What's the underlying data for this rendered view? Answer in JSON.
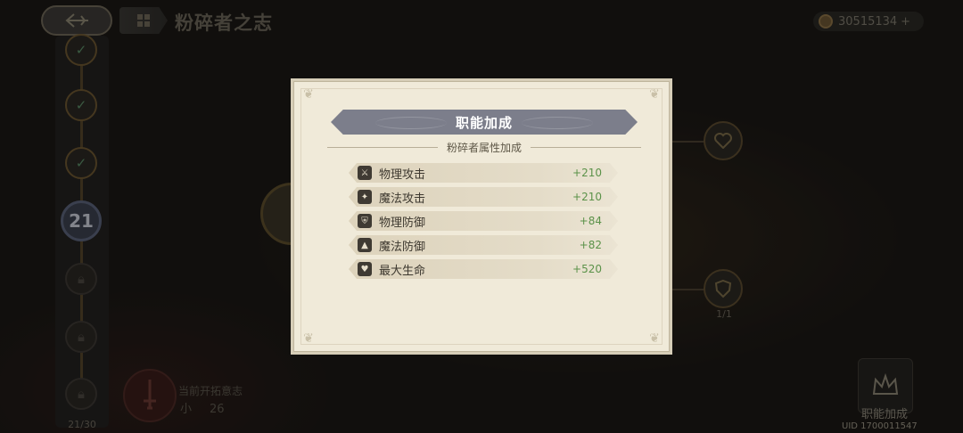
{
  "header": {
    "title": "粉碎者之志",
    "currency_value": "30515134",
    "currency_plus": "+"
  },
  "track": {
    "current_level": "21",
    "progress": "21/30"
  },
  "bottom_left": {
    "label": "当前开拓意志",
    "value": "26"
  },
  "right": {
    "node_count": "1/1",
    "job_bonus_button": "职能加成",
    "uid": "UID 1700011547"
  },
  "modal": {
    "title": "职能加成",
    "subtitle": "粉碎者属性加成",
    "attributes": [
      {
        "name": "物理攻击",
        "value": "+210",
        "icon": "sword-icon"
      },
      {
        "name": "魔法攻击",
        "value": "+210",
        "icon": "wand-icon"
      },
      {
        "name": "物理防御",
        "value": "+84",
        "icon": "shield-icon"
      },
      {
        "name": "魔法防御",
        "value": "+82",
        "icon": "hat-icon"
      },
      {
        "name": "最大生命",
        "value": "+520",
        "icon": "heart-icon"
      }
    ]
  },
  "colors": {
    "modal_bg": "#f0ead9",
    "header_bg": "#7c7e8b",
    "value_green": "#5b9249",
    "page_bg": "#1b1815"
  }
}
